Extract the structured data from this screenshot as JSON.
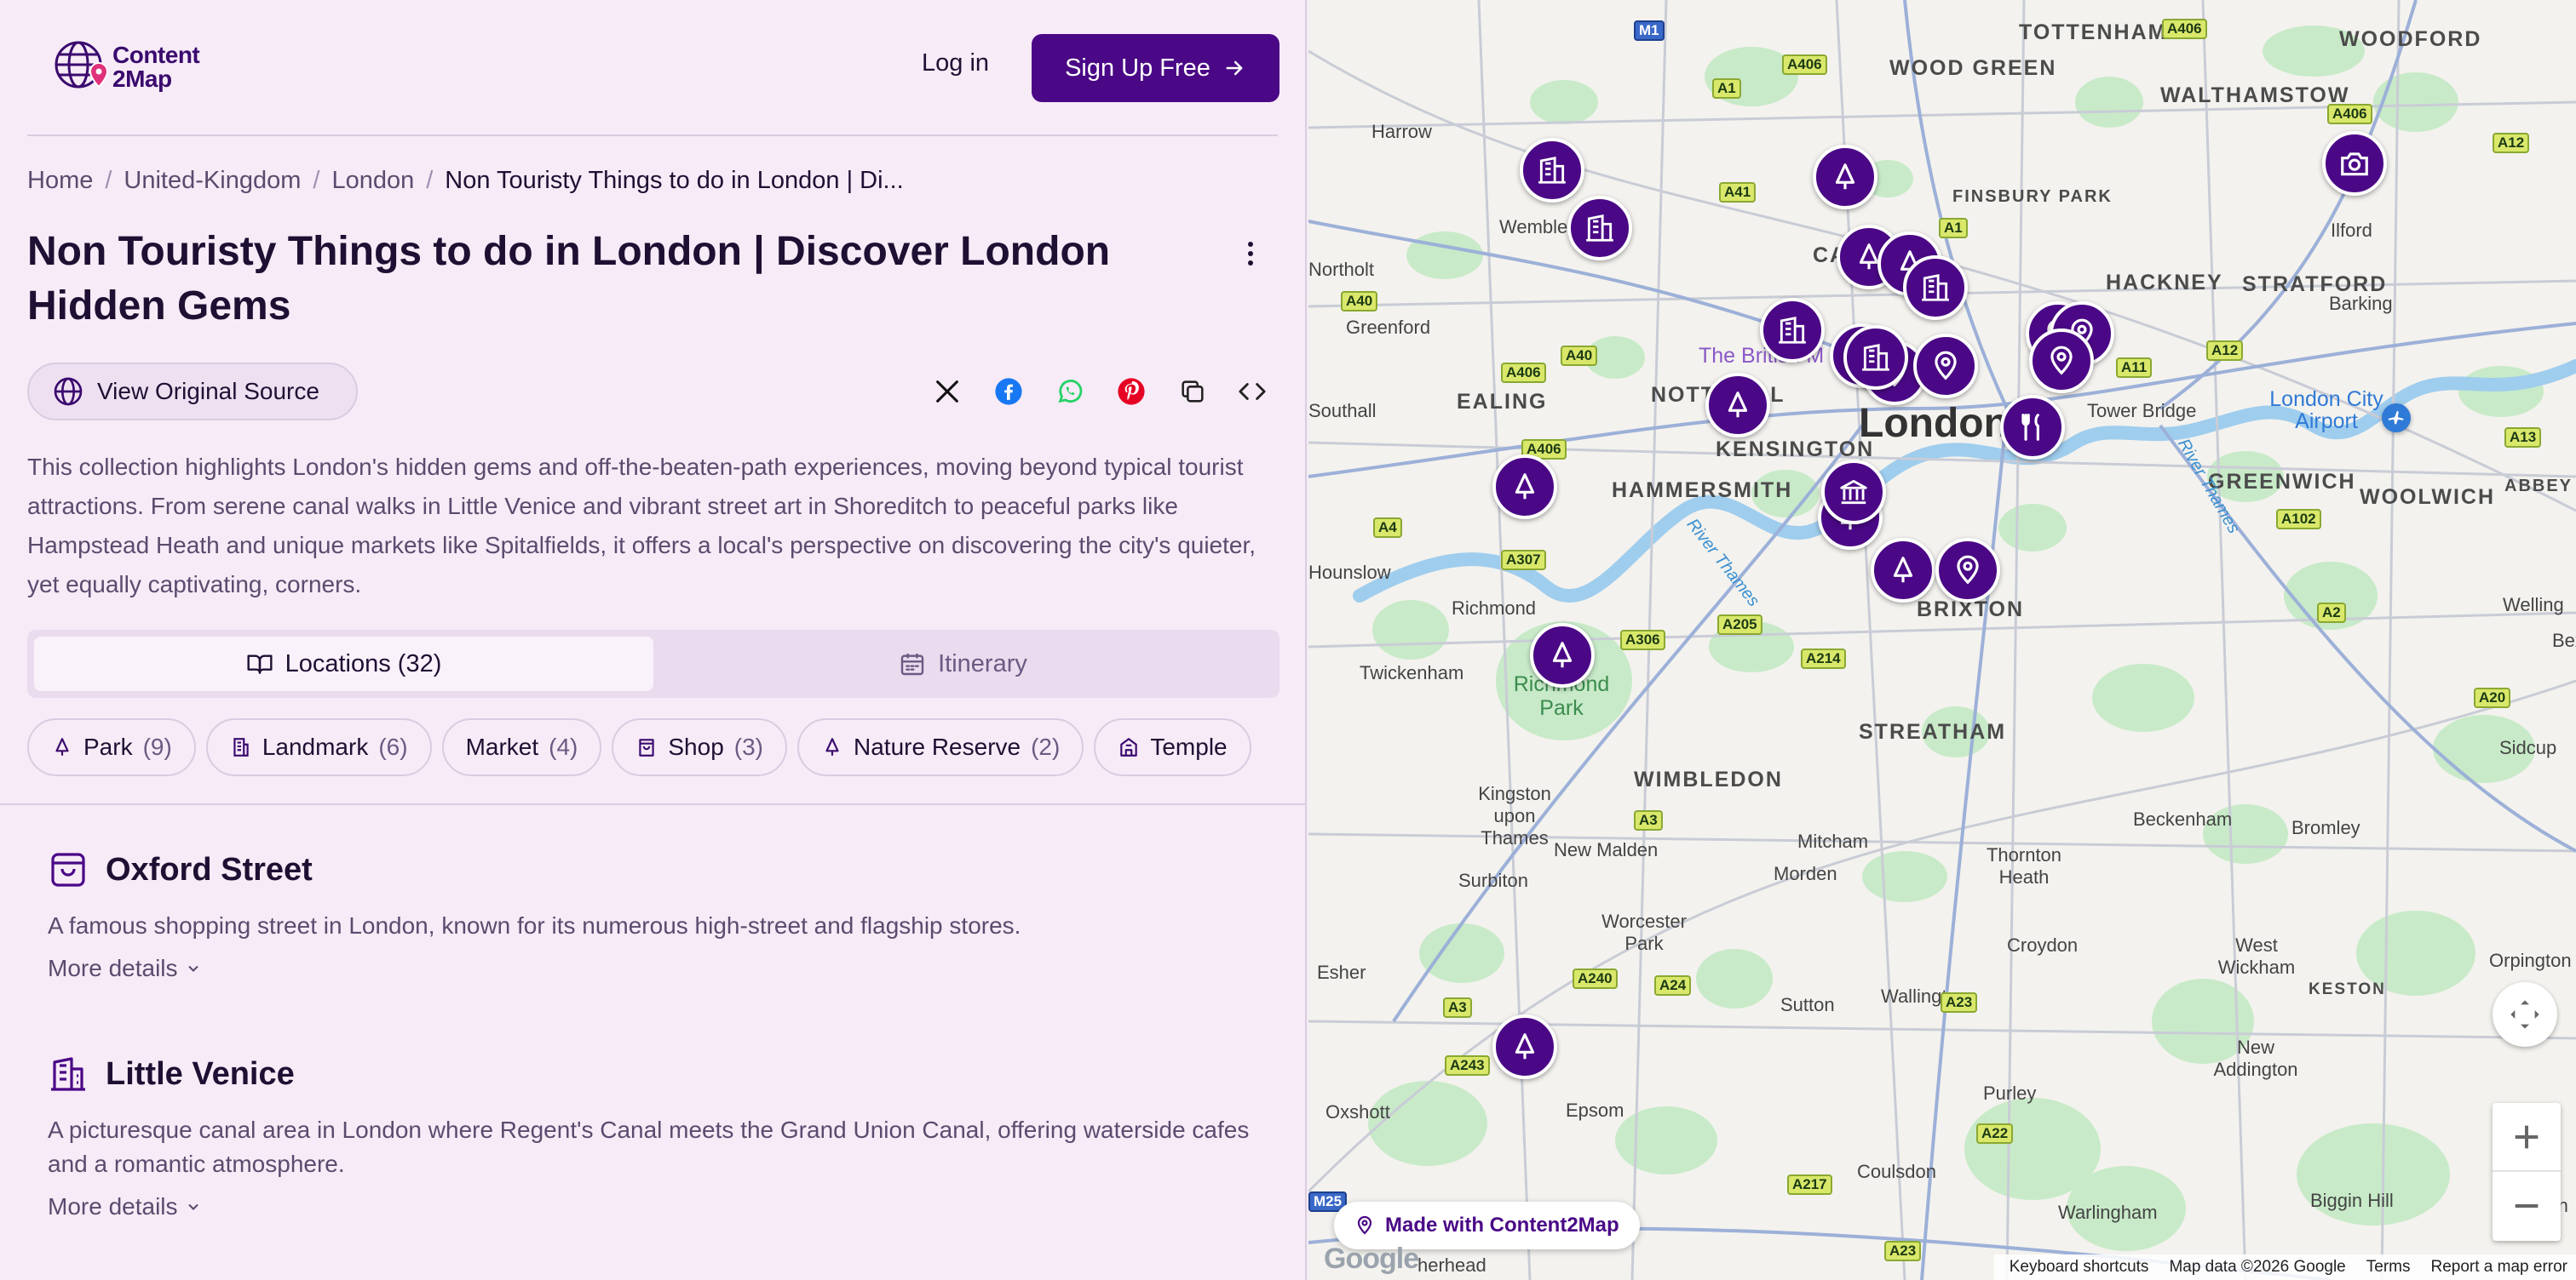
{
  "header": {
    "logo_line1": "Content",
    "logo_line2": "2Map",
    "login_label": "Log in",
    "signup_label": "Sign Up Free"
  },
  "breadcrumb": {
    "items": [
      "Home",
      "United-Kingdom",
      "London"
    ],
    "current": "Non Touristy Things to do in London | Di...",
    "separator": "/"
  },
  "page": {
    "title": "Non Touristy Things to do in London | Discover London Hidden Gems",
    "source_button": "View Original Source",
    "description": "This collection highlights London's hidden gems and off-the-beaten-path experiences, moving beyond typical tourist attractions. From serene canal walks in Little Venice and vibrant street art in Shoreditch to peaceful parks like Hampstead Heath and unique markets like Spitalfields, it offers a local's perspective on discovering the city's quieter, yet equally captivating, corners."
  },
  "share_icons": [
    "x-icon",
    "facebook-icon",
    "whatsapp-icon",
    "pinterest-icon",
    "copy-icon",
    "embed-icon"
  ],
  "tabs": {
    "locations": "Locations (32)",
    "itinerary": "Itinerary",
    "active": "locations"
  },
  "filters": [
    {
      "label": "Park",
      "count": "(9)",
      "icon": "tree-icon"
    },
    {
      "label": "Landmark",
      "count": "(6)",
      "icon": "building-icon"
    },
    {
      "label": "Market",
      "count": "(4)",
      "icon": ""
    },
    {
      "label": "Shop",
      "count": "(3)",
      "icon": "bag-icon"
    },
    {
      "label": "Nature Reserve",
      "count": "(2)",
      "icon": "tree-icon"
    },
    {
      "label": "Temple",
      "count": "",
      "icon": "temple-icon"
    }
  ],
  "locations": [
    {
      "name": "Oxford Street",
      "description": "A famous shopping street in London, known for its numerous high-street and flagship stores.",
      "more": "More details",
      "icon": "shopping-bag-icon"
    },
    {
      "name": "Little Venice",
      "description": "A picturesque canal area in London where Regent's Canal meets the Grand Union Canal, offering waterside cafes and a romantic atmosphere.",
      "more": "More details",
      "icon": "building-icon"
    }
  ],
  "map": {
    "city_label": "London",
    "areas": [
      "TOTTENHAM",
      "WOODFORD",
      "WOOD GREEN",
      "WALTHAMSTOW",
      "HACKNEY",
      "STRATFORD",
      "CAMDEN",
      "EALING",
      "KENSINGTON",
      "HAMMERSMITH",
      "GREENWICH",
      "WOOLWICH",
      "ABBEY WO",
      "BRIXTON",
      "STREATHAM",
      "WIMBLEDON",
      "NOTTI HILL",
      "KESTON",
      "FINSBURY PARK"
    ],
    "towns": [
      "Harrow",
      "Wembley",
      "Ilford",
      "Barking",
      "Greenford",
      "Northolt",
      "Southall",
      "Hounslow",
      "Richmond",
      "Twickenham",
      "Kingston upon Thames",
      "New Malden",
      "Surbiton",
      "Mitcham",
      "Morden",
      "Worcester Park",
      "Thornton Heath",
      "Croydon",
      "Sutton",
      "Wallington",
      "West Wickham",
      "Beckenham",
      "Bromley",
      "Sidcup",
      "Welling",
      "Orpington",
      "New Addington",
      "Purley",
      "Coulsdon",
      "Esher",
      "Epsom",
      "Oxshott",
      "Warlingham",
      "Biggin Hill",
      "Tower Bridge",
      "Bexl",
      "Kn"
    ],
    "pois": [
      "The British M"
    ],
    "airport": "London City Airport",
    "park": "Richmond Park",
    "river": "River Thames",
    "roads": [
      "A406",
      "M1",
      "A1",
      "A41",
      "A40",
      "A12",
      "A11",
      "A13",
      "A4",
      "A307",
      "A306",
      "A205",
      "A214",
      "A3",
      "A240",
      "A24",
      "A23",
      "A22",
      "A217",
      "A243",
      "A2",
      "A20",
      "A102",
      "M25"
    ],
    "made_with": "Made with Content2Map",
    "footer": [
      "Keyboard shortcuts",
      "Map data ©2026 Google",
      "Terms",
      "Report a map error"
    ],
    "google_logo": "Google",
    "bottom_town": "herhead"
  },
  "colors": {
    "brand": "#4a0886",
    "panel_bg": "#f7ebf7",
    "text": "#1d1033",
    "muted": "#5b4b6e"
  }
}
